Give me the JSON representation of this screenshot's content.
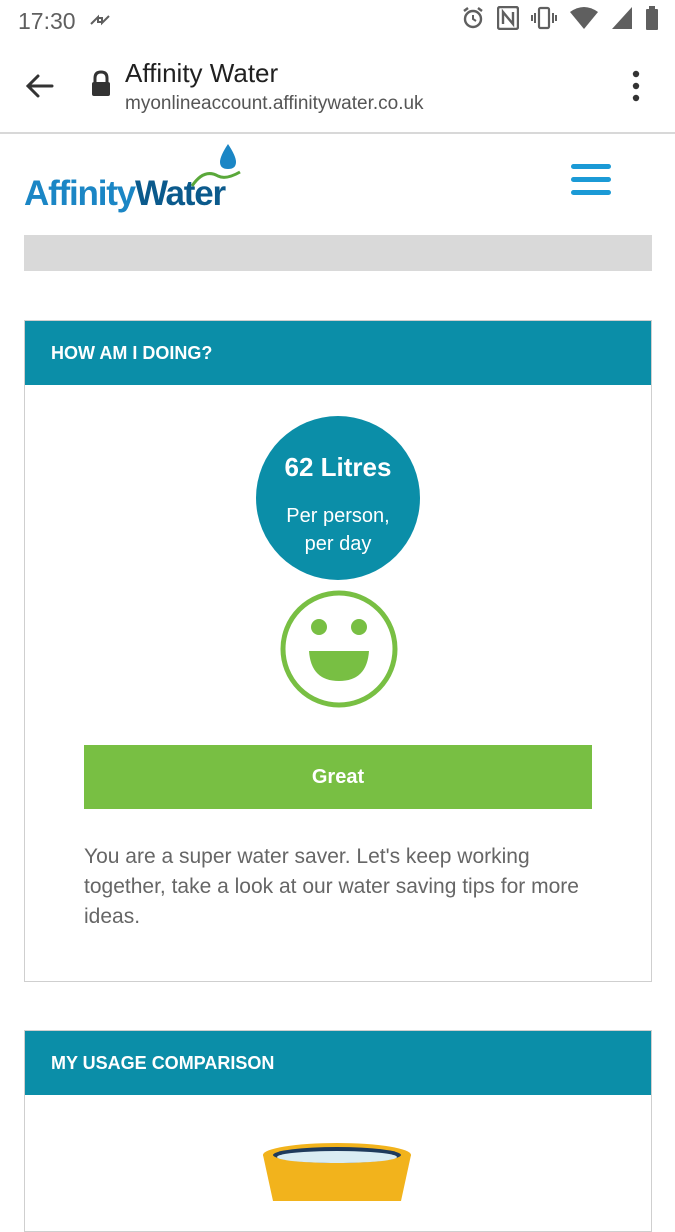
{
  "status_bar": {
    "time": "17:30"
  },
  "browser": {
    "title": "Affinity Water",
    "url": "myonlineaccount.affinitywater.co.uk"
  },
  "site": {
    "logo_part1": "Affinity",
    "logo_part2": "Water"
  },
  "card_how": {
    "header": "HOW AM I DOING?",
    "usage_value": "62 Litres",
    "usage_line1": "Per person,",
    "usage_line2": "per day",
    "rating": "Great",
    "message": "You are a super water saver. Let's keep working together, take a look at our water saving tips for more ideas."
  },
  "card_comparison": {
    "header": "MY USAGE COMPARISON"
  },
  "colors": {
    "brand_teal": "#0b8ea8",
    "rating_green": "#78bf43",
    "logo_blue": "#1b86c5",
    "hamburger_blue": "#1b9ad6"
  }
}
